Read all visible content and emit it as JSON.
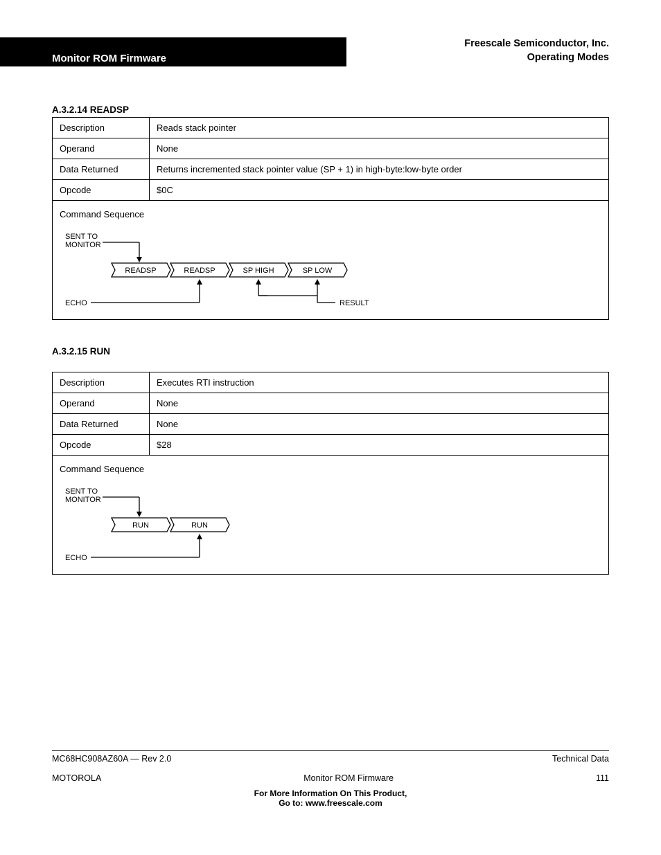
{
  "header": {
    "running_head": "Monitor ROM Firmware",
    "company_line1": "Freescale Semiconductor, Inc.",
    "company_line2": "Operating Modes"
  },
  "subsection1": {
    "a": "A.3.2.14  READSP",
    "b": "A.3.2.15  RUN"
  },
  "tables": {
    "readsp": {
      "rows": [
        [
          "Description",
          "Reads stack pointer"
        ],
        [
          "Operand",
          "None"
        ],
        [
          "Data Returned",
          "Returns incremented stack pointer value (SP + 1) in high-byte:low-byte order"
        ],
        [
          "Opcode",
          "$0C"
        ]
      ],
      "seq_label": "Command Sequence",
      "diagram": {
        "sent": "SENT TO MONITOR",
        "echo": "ECHO",
        "result": "RESULT",
        "cells": [
          "READSP",
          "READSP",
          "SP HIGH",
          "SP LOW"
        ]
      }
    },
    "run": {
      "rows": [
        [
          "Description",
          "Executes RTI instruction"
        ],
        [
          "Operand",
          "None"
        ],
        [
          "Data Returned",
          "None"
        ],
        [
          "Opcode",
          "$28"
        ]
      ],
      "seq_label": "Command Sequence",
      "diagram": {
        "sent": "SENT TO MONITOR",
        "echo": "ECHO",
        "cells": [
          "RUN",
          "RUN"
        ]
      }
    }
  },
  "footer": {
    "left": "MC68HC908AZ60A — Rev 2.0",
    "center": "For More Information On This Product,\n  Go to: www.freescale.com",
    "right_label": "Technical Data",
    "page_left": "MOTOROLA",
    "page_mid": "Monitor ROM Firmware",
    "page_right": "111"
  }
}
